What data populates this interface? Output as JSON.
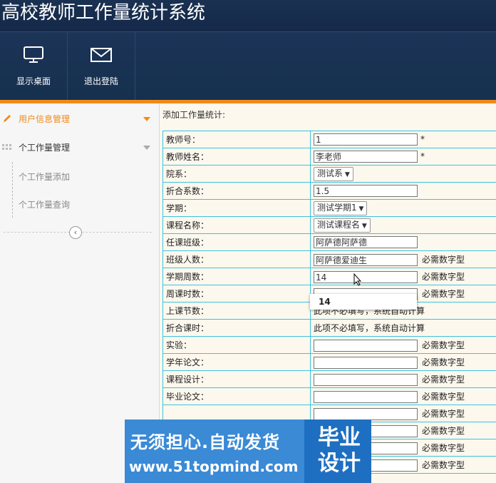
{
  "app": {
    "title": "高校教师工作量统计系统"
  },
  "toolbar": {
    "items": [
      {
        "label": "显示桌面",
        "icon": "monitor-icon"
      },
      {
        "label": "退出登陆",
        "icon": "envelope-icon"
      }
    ]
  },
  "colors": {
    "accent": "#f08a1a",
    "header": "#1a3152",
    "table_border": "#3cc3e0"
  },
  "sidebar": {
    "items": [
      {
        "label": "用户信息管理",
        "icon": "pencil-icon"
      },
      {
        "label": "个工作量管理",
        "icon": "grid-icon"
      }
    ],
    "subitems": [
      "个工作量添加",
      "个工作量查询"
    ],
    "collapse_glyph": "‹"
  },
  "main": {
    "heading": "添加工作量统计:",
    "rows": [
      {
        "label": "教师号：",
        "value": "1",
        "type": "input",
        "suffix": "*"
      },
      {
        "label": "教师姓名：",
        "value": "李老师",
        "type": "input",
        "suffix": "*"
      },
      {
        "label": "院系：",
        "value": "测试系",
        "type": "select",
        "suffix": ""
      },
      {
        "label": "折合系数：",
        "value": "1.5",
        "type": "input",
        "suffix": ""
      },
      {
        "label": "学期：",
        "value": "测试学期1",
        "type": "select",
        "suffix": ""
      },
      {
        "label": "课程名称：",
        "value": "测试课程名",
        "type": "select",
        "suffix": ""
      },
      {
        "label": "任课班级：",
        "value": "阿萨德阿萨德",
        "type": "input",
        "suffix": ""
      },
      {
        "label": "班级人数：",
        "value": "阿萨德爱迪生",
        "type": "input",
        "suffix": "必需数字型"
      },
      {
        "label": "学期周数：",
        "value": "14",
        "type": "input",
        "suffix": "必需数字型"
      },
      {
        "label": "周课时数：",
        "value": "",
        "type": "input",
        "suffix": "必需数字型"
      },
      {
        "label": "上课节数：",
        "value": "此项不必填写，系统自动计算",
        "type": "text",
        "suffix": ""
      },
      {
        "label": "折合课时：",
        "value": "此项不必填写，系统自动计算",
        "type": "text",
        "suffix": ""
      },
      {
        "label": "实验：",
        "value": "",
        "type": "input",
        "suffix": "必需数字型"
      },
      {
        "label": "学年论文：",
        "value": "",
        "type": "input",
        "suffix": "必需数字型"
      },
      {
        "label": "课程设计：",
        "value": "",
        "type": "input",
        "suffix": "必需数字型"
      },
      {
        "label": "毕业论文：",
        "value": "",
        "type": "input",
        "suffix": "必需数字型"
      },
      {
        "label": "",
        "value": "",
        "type": "input",
        "suffix": "必需数字型"
      },
      {
        "label": "",
        "value": "",
        "type": "input",
        "suffix": "必需数字型"
      },
      {
        "label": "",
        "value": "",
        "type": "input",
        "suffix": "必需数字型"
      },
      {
        "label": "",
        "value": "",
        "type": "input",
        "suffix": "必需数字型"
      }
    ],
    "autocomplete": "14"
  },
  "watermark": {
    "line1": "无须担心.自动发货",
    "line2": "www.51topmind.com",
    "badge": "毕业设计"
  }
}
